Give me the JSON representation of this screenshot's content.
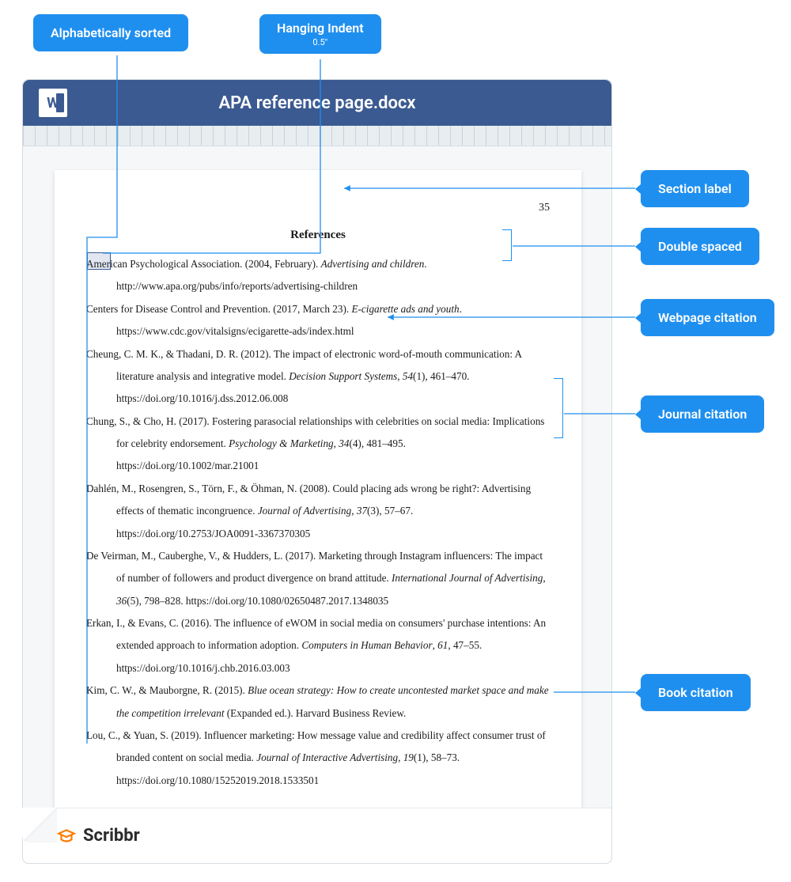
{
  "badges": {
    "alpha": "Alphabetically sorted",
    "hanging": "Hanging Indent",
    "hanging_sub": "0.5\"",
    "section": "Section label",
    "double": "Double spaced",
    "webpage": "Webpage citation",
    "journal": "Journal citation",
    "book": "Book citation"
  },
  "doc_title": "APA reference page.docx",
  "page_number": "35",
  "heading": "References",
  "brand": "Scribbr",
  "references": [
    {
      "pre": "American Psychological Association. (2004, February). ",
      "it": "Advertising and children",
      "post": ". http://www.apa.org/pubs/info/reports/advertising-children"
    },
    {
      "pre": "Centers for Disease Control and Prevention. (2017, March 23). ",
      "it": "E-cigarette ads and youth",
      "post": ". https://www.cdc.gov/vitalsigns/ecigarette-ads/index.html"
    },
    {
      "pre": "Cheung, C. M. K., & Thadani, D. R. (2012). The impact of electronic word-of-mouth communication: A literature analysis and integrative model. ",
      "it": "Decision Support Systems",
      "post": ", ",
      "it2": "54",
      "post2": "(1), 461–470. https://doi.org/10.1016/j.dss.2012.06.008"
    },
    {
      "pre": "Chung, S., & Cho, H. (2017). Fostering parasocial relationships with celebrities on social media: Implications for celebrity endorsement. ",
      "it": "Psychology & Marketing",
      "post": ", ",
      "it2": "34",
      "post2": "(4), 481–495. https://doi.org/10.1002/mar.21001"
    },
    {
      "pre": "Dahlén, M., Rosengren, S., Törn, F., & Öhman, N. (2008). Could placing ads wrong be right?: Advertising effects of thematic incongruence. ",
      "it": "Journal of Advertising",
      "post": ", ",
      "it2": "37",
      "post2": "(3), 57–67. https://doi.org/10.2753/JOA0091-3367370305"
    },
    {
      "pre": "De Veirman, M., Cauberghe, V., & Hudders, L. (2017). Marketing through Instagram influencers: The impact of number of followers and product divergence on brand attitude. ",
      "it": "International Journal of Advertising",
      "post": ", ",
      "it2": "36",
      "post2": "(5), 798–828. https://doi.org/10.1080/02650487.2017.1348035"
    },
    {
      "pre": "Erkan, I., & Evans, C. (2016). The influence of eWOM in social media on consumers' purchase intentions: An extended approach to information adoption. ",
      "it": "Computers in Human Behavior",
      "post": ", ",
      "it2": "61",
      "post2": ", 47–55. https://doi.org/10.1016/j.chb.2016.03.003"
    },
    {
      "pre": "Kim, C. W., & Mauborgne, R. (2015). ",
      "it": "Blue ocean strategy: How to create uncontested market space and make the competition irrelevant",
      "post": " (Expanded ed.). Harvard Business Review."
    },
    {
      "pre": "Lou, C., & Yuan, S. (2019). Influencer marketing: How message value and credibility affect consumer trust of branded content on social media. ",
      "it": "Journal of Interactive Advertising",
      "post": ", ",
      "it2": "19",
      "post2": "(1), 58–73. https://doi.org/10.1080/15252019.2018.1533501"
    }
  ]
}
